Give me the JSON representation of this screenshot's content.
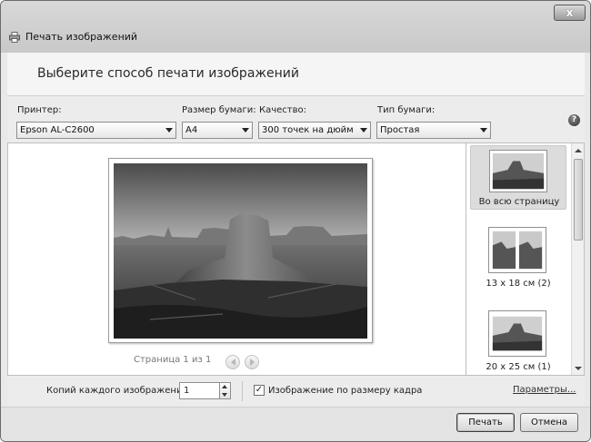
{
  "window": {
    "title": "Печать изображений",
    "close_glyph": "x"
  },
  "header": {
    "heading": "Выберите способ печати изображений"
  },
  "options": {
    "printer": {
      "label": "Принтер:",
      "value": "Epson AL-C2600"
    },
    "paper_size": {
      "label": "Размер бумаги:",
      "value": "A4"
    },
    "quality": {
      "label": "Качество:",
      "value": "300 точек на дюйм"
    },
    "paper_type": {
      "label": "Тип бумаги:",
      "value": "Простая"
    },
    "help_glyph": "?"
  },
  "preview": {
    "page_label": "Страница 1 из 1"
  },
  "layouts": {
    "items": [
      {
        "label": "Во всю страницу",
        "selected": true
      },
      {
        "label": "13 x 18 см (2)",
        "selected": false
      },
      {
        "label": "20 x 25 см (1)",
        "selected": false
      }
    ]
  },
  "copies": {
    "label": "Копий каждого изображения:",
    "value": "1"
  },
  "fit": {
    "checked_glyph": "✓",
    "label": "Изображение по размеру кадра"
  },
  "params_link": "Параметры...",
  "footer": {
    "print_button": "Печать",
    "cancel_button": "Отмена"
  }
}
